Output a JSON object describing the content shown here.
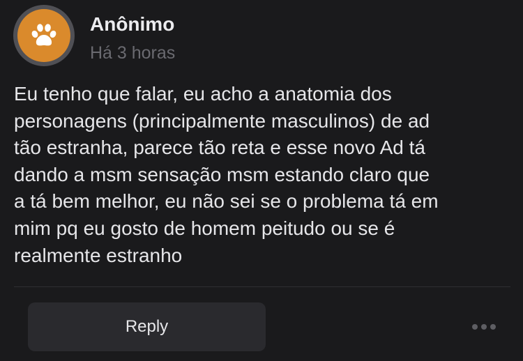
{
  "post": {
    "author": "Anônimo",
    "time": "Há 3 horas",
    "avatar_icon": "paw-icon",
    "avatar_color": "#da8a2c",
    "body": "Eu tenho que falar, eu acho a anatomia dos\npersonagens (principalmente masculinos) de ad\ntão estranha, parece tão reta e esse novo Ad tá\ndando a msm sensação msm estando claro que\na tá bem melhor, eu não sei se o problema tá em\nmim pq eu gosto de homem peitudo ou se é\nrealmente estranho"
  },
  "actions": {
    "reply_label": "Reply",
    "more_icon": "more-horizontal-icon"
  }
}
